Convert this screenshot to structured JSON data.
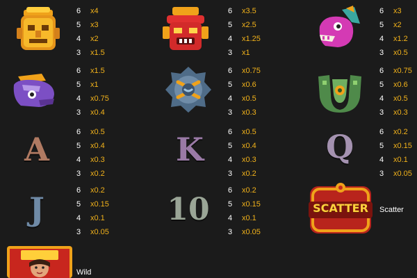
{
  "paytable": [
    {
      "symbol": "gold-mask-icon",
      "rows": [
        {
          "count": "6",
          "mult": "x4"
        },
        {
          "count": "5",
          "mult": "x3"
        },
        {
          "count": "4",
          "mult": "x2"
        },
        {
          "count": "3",
          "mult": "x1.5"
        }
      ]
    },
    {
      "symbol": "red-mask-icon",
      "rows": [
        {
          "count": "6",
          "mult": "x3.5"
        },
        {
          "count": "5",
          "mult": "x2.5"
        },
        {
          "count": "4",
          "mult": "x1.25"
        },
        {
          "count": "3",
          "mult": "x1"
        }
      ]
    },
    {
      "symbol": "pink-serpent-icon",
      "rows": [
        {
          "count": "6",
          "mult": "x3"
        },
        {
          "count": "5",
          "mult": "x2"
        },
        {
          "count": "4",
          "mult": "x1.2"
        },
        {
          "count": "3",
          "mult": "x0.5"
        }
      ]
    },
    {
      "symbol": "purple-serpent-icon",
      "rows": [
        {
          "count": "6",
          "mult": "x1.5"
        },
        {
          "count": "5",
          "mult": "x1"
        },
        {
          "count": "4",
          "mult": "x0.75"
        },
        {
          "count": "3",
          "mult": "x0.4"
        }
      ]
    },
    {
      "symbol": "blue-stone-icon",
      "rows": [
        {
          "count": "6",
          "mult": "x0.75"
        },
        {
          "count": "5",
          "mult": "x0.6"
        },
        {
          "count": "4",
          "mult": "x0.5"
        },
        {
          "count": "3",
          "mult": "x0.3"
        }
      ]
    },
    {
      "symbol": "green-idol-icon",
      "rows": [
        {
          "count": "6",
          "mult": "x0.75"
        },
        {
          "count": "5",
          "mult": "x0.6"
        },
        {
          "count": "4",
          "mult": "x0.5"
        },
        {
          "count": "3",
          "mult": "x0.3"
        }
      ]
    },
    {
      "symbol": "A",
      "rows": [
        {
          "count": "6",
          "mult": "x0.5"
        },
        {
          "count": "5",
          "mult": "x0.4"
        },
        {
          "count": "4",
          "mult": "x0.3"
        },
        {
          "count": "3",
          "mult": "x0.2"
        }
      ]
    },
    {
      "symbol": "K",
      "rows": [
        {
          "count": "6",
          "mult": "x0.5"
        },
        {
          "count": "5",
          "mult": "x0.4"
        },
        {
          "count": "4",
          "mult": "x0.3"
        },
        {
          "count": "3",
          "mult": "x0.2"
        }
      ]
    },
    {
      "symbol": "Q",
      "rows": [
        {
          "count": "6",
          "mult": "x0.2"
        },
        {
          "count": "5",
          "mult": "x0.15"
        },
        {
          "count": "4",
          "mult": "x0.1"
        },
        {
          "count": "3",
          "mult": "x0.05"
        }
      ]
    },
    {
      "symbol": "J",
      "rows": [
        {
          "count": "6",
          "mult": "x0.2"
        },
        {
          "count": "5",
          "mult": "x0.15"
        },
        {
          "count": "4",
          "mult": "x0.1"
        },
        {
          "count": "3",
          "mult": "x0.05"
        }
      ]
    },
    {
      "symbol": "10",
      "rows": [
        {
          "count": "6",
          "mult": "x0.2"
        },
        {
          "count": "5",
          "mult": "x0.15"
        },
        {
          "count": "4",
          "mult": "x0.1"
        },
        {
          "count": "3",
          "mult": "x0.05"
        }
      ]
    }
  ],
  "scatter": {
    "symbol_text": "SCATTER",
    "label": "Scatter"
  },
  "wild": {
    "symbol": "wild-queen-icon",
    "label": "Wild"
  },
  "colors": {
    "multiplier": "#f2b21b",
    "count": "#ffffff",
    "background": "#1b1b1b"
  }
}
